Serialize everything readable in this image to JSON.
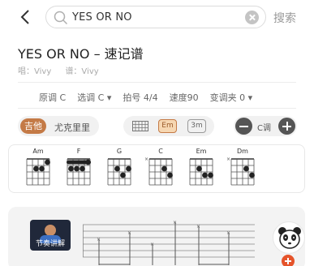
{
  "header": {
    "search_value": "YES OR NO",
    "search_button": "搜索"
  },
  "song": {
    "title": "YES OR NO – 速记谱",
    "singer_label": "唱：Vivy",
    "score_label": "谱：Vivy"
  },
  "settings": {
    "original_key": "原调 C",
    "chosen_key": "选调 C ▾",
    "time_signature": "拍号 4/4",
    "tempo": "速度90",
    "capo": "变调夹 0 ▾"
  },
  "controls": {
    "instrument_tag": "吉他",
    "instrument_name": "尤克里里",
    "diagram_em": "Em",
    "diagram_3m": "3m",
    "key_label": "C调"
  },
  "chords": [
    {
      "name": "Am"
    },
    {
      "name": "F"
    },
    {
      "name": "G"
    },
    {
      "name": "C"
    },
    {
      "name": "Em"
    },
    {
      "name": "Dm"
    }
  ],
  "video": {
    "label": "节奏讲解"
  },
  "colors": {
    "accent": "#c47a46",
    "accent_light": "#f6d7b2",
    "add_button": "#e5542b"
  }
}
